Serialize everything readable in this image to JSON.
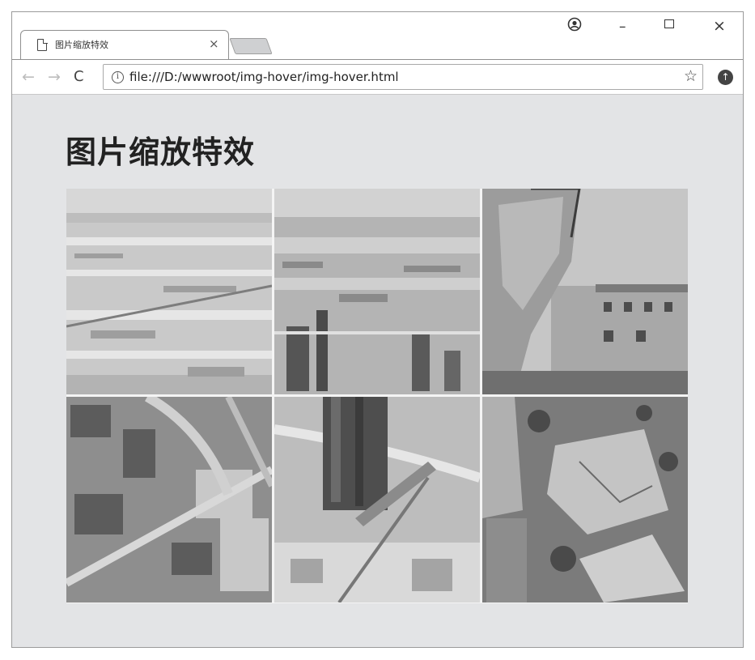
{
  "browser": {
    "tab_title": "图片缩放特效",
    "tab_close": "×",
    "url": "file:///D:/wwwroot/img-hover/img-hover.html",
    "window_controls": {
      "account": "account-icon",
      "minimize": "–",
      "maximize": "maximize-icon",
      "close": "×"
    },
    "nav": {
      "back": "←",
      "forward": "→",
      "reload": "C"
    },
    "icons": {
      "info": "i",
      "bookmark": "☆",
      "extension": "↑"
    }
  },
  "page": {
    "title": "图片缩放特效",
    "images": [
      {
        "subject": "aerial-city-overview"
      },
      {
        "subject": "aerial-city-skyscrapers"
      },
      {
        "subject": "damaged-buildings"
      },
      {
        "subject": "aerial-city-roads"
      },
      {
        "subject": "tower-construction-site"
      },
      {
        "subject": "collapsed-rubble"
      }
    ]
  },
  "colors": {
    "page_background": "#e3e4e6",
    "title_text": "#222222"
  }
}
